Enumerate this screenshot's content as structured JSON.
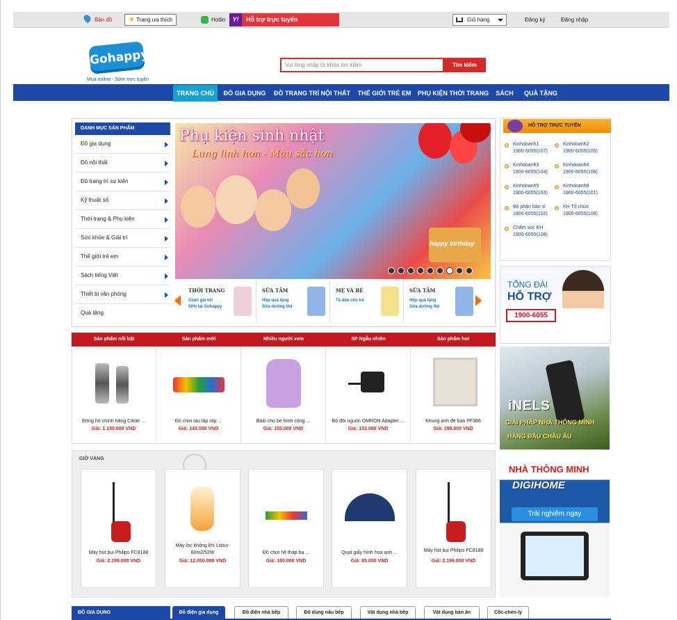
{
  "topbar": {
    "map_label": "Bản đồ",
    "favorites_label": "Trang ưa thích",
    "hotline_label": "Hotlin",
    "online_support_label": "Hỗ trợ trực tuyến",
    "cart_label": "Giỏ hàng",
    "register_label": "Đăng ký",
    "login_label": "Đăng nhập"
  },
  "logo": {
    "text": "Gohappy",
    "sub": ".vn",
    "tagline": "Mua online - Sớm trực tuyến"
  },
  "search": {
    "placeholder": "Vui lòng nhập từ khóa tìm kiếm",
    "button": "Tìm kiếm"
  },
  "nav": [
    "TRANG CHỦ",
    "ĐỒ GIA DỤNG",
    "ĐỒ TRANG TRÍ NỘI THẤT",
    "THẾ GIỚI TRẺ EM",
    "PHỤ KIỆN THỜI TRANG",
    "SÁCH",
    "QUÀ TẶNG"
  ],
  "categories": {
    "title": "DANH MỤC SẢN PHẨM",
    "items": [
      "Đồ gia dụng",
      "Đồ nội thất",
      "Đồ trang trí sự kiện",
      "Kỹ thuật số",
      "Thời trang & Phụ kiện",
      "Sức khỏe & Giải trí",
      "Thế giới trẻ em",
      "Sách tiếng Việt",
      "Thiết bị văn phòng",
      "Quà tặng"
    ]
  },
  "banner": {
    "title": "Phụ kiện sinh nhật",
    "subtitle": "Lung linh hơn - Màu sắc hơn",
    "cake_text": "happy birthday"
  },
  "promos": [
    {
      "title": "THỜI TRANG",
      "line1": "Giảm giá tới",
      "line2": "50% tại Gohappy"
    },
    {
      "title": "SỮA TẮM",
      "line1": "Hộp quà tặng",
      "line2": "Sữa dưỡng thể"
    },
    {
      "title": "MẸ VÀ BÉ",
      "line1": "Tã dán cho trẻ",
      "line2": ""
    },
    {
      "title": "SỮA TẮM",
      "line1": "Hộp quà tặng",
      "line2": "Sữa dưỡng thể"
    }
  ],
  "support": {
    "title": "HỖ TRỢ TRỰC TUYẾN",
    "items": [
      {
        "name": "Kinhdoanh1",
        "phone": "1900-6055(107)"
      },
      {
        "name": "Kinhdoanh2",
        "phone": "1900-6055(105)"
      },
      {
        "name": "Kinhdoanh3",
        "phone": "1900-6055(104)"
      },
      {
        "name": "Kinhdoanh4",
        "phone": "1900-6055(106)"
      },
      {
        "name": "Kinhdoanh5",
        "phone": "1900-6055(103)"
      },
      {
        "name": "Kinhdoanh6",
        "phone": "1900-6055(101)"
      },
      {
        "name": "Bộ phận bán sỉ",
        "phone": "1900-6055(102)"
      },
      {
        "name": "KH Tổ chức",
        "phone": "1900-6055(108)"
      },
      {
        "name": "Chăm sóc KH",
        "phone": "1900-6055(108)"
      }
    ]
  },
  "tongdai": {
    "line1": "TỔNG ĐÀI",
    "line2": "HỖ TRỢ",
    "phone": "1900-6055"
  },
  "inels": {
    "logo": "iNELS",
    "line1": "GIẢI PHÁP NHÀ THÔNG MINH",
    "line2": "HÀNG ĐẦU CHÂU ÂU"
  },
  "digihome": {
    "line1": "NHÀ THÔNG MINH",
    "logo": "DIGIHOME",
    "button": "Trải nghiệm ngay"
  },
  "product_tabs": [
    "Sản phẩm nổi bật",
    "Sản phẩm mới",
    "Nhiều người xem",
    "SP Ngẫu nhiên",
    "Sản phẩm hot"
  ],
  "products": [
    {
      "name": "Đồng hồ chính hãng Citole ...",
      "price": "Giá: 1.150.000 VND"
    },
    {
      "name": "Đồ chơi tàu lắp ráp ...",
      "price": "Giá: 145.000 VND"
    },
    {
      "name": "Balo cho bé hình công ...",
      "price": "Giá: 155.000 VND"
    },
    {
      "name": "Bộ đổi nguồn OMRON Adapter ...",
      "price": "Giá: 153.000 VND"
    },
    {
      "name": "Khung ảnh để bàn PF366",
      "price": "Giá: 199.000 VND"
    }
  ],
  "golden_hour": {
    "title": "GIỜ VÀNG",
    "items": [
      {
        "name": "Máy hút bụi Philips FC8188",
        "price": "Giá: 2.199.000 VND"
      },
      {
        "name": "Máy lọc không khí Lotus-60m2/52W",
        "price": "Giá: 12.050.000 VND"
      },
      {
        "name": "Đồ chơi hề tháp ba ...",
        "price": "Giá: 165.000 VND"
      },
      {
        "name": "Quạt giấy hình hoa anh ...",
        "price": "Giá: 85.000 VND"
      },
      {
        "name": "Máy hút bụi Philips FC8188",
        "price": "Giá: 2.199.000 VND"
      }
    ]
  },
  "bottom": {
    "category": "ĐỒ GIA DỤNG",
    "tabs": [
      "Đồ điện gia dụng",
      "Đồ điện nhà bếp",
      "Đồ dùng nấu bếp",
      "Vật dụng nhà bếp",
      "Vật dụng bàn ăn",
      "Cốc-chén-ly"
    ]
  },
  "colors": {
    "brand_blue": "#1f49a8",
    "accent_red": "#c2181f",
    "active_nav": "#17a0d0",
    "support_orange": "#f39c12"
  }
}
